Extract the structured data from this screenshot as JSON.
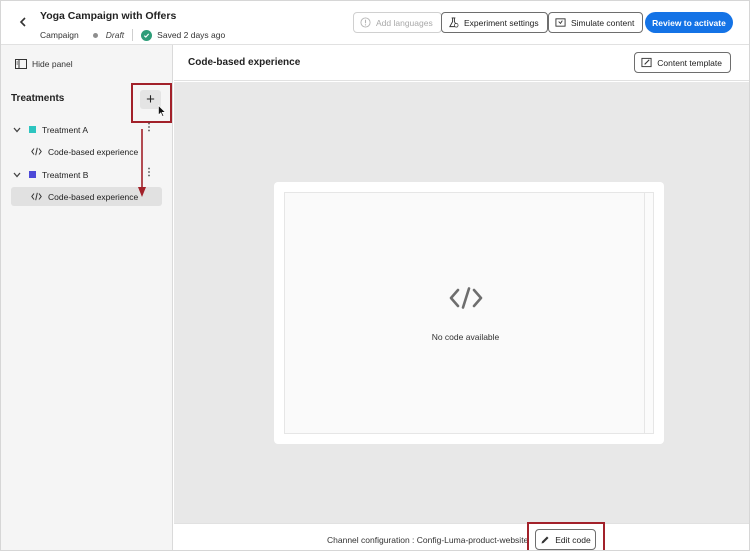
{
  "header": {
    "title": "Yoga Campaign with Offers",
    "type": "Campaign",
    "status": "Draft",
    "saved": "Saved 2 days ago",
    "add_languages": "Add languages",
    "experiment_settings": "Experiment settings",
    "simulate_content": "Simulate content",
    "review_activate": "Review to activate"
  },
  "sidebar": {
    "hide_panel": "Hide panel",
    "treatments_title": "Treatments",
    "items": [
      {
        "label": "Treatment A",
        "color": "#2dc5c0",
        "child": "Code-based experience"
      },
      {
        "label": "Treatment B",
        "color": "#4d4ad8",
        "child": "Code-based experience"
      }
    ]
  },
  "main": {
    "title": "Code-based experience",
    "content_template": "Content template",
    "empty_message": "No code available"
  },
  "footer": {
    "channel_config": "Channel configuration : Config-Luma-product-website",
    "edit_code": "Edit code"
  },
  "colors": {
    "accent": "#1473e6",
    "highlight": "#a2212a",
    "success": "#2d9d78"
  }
}
